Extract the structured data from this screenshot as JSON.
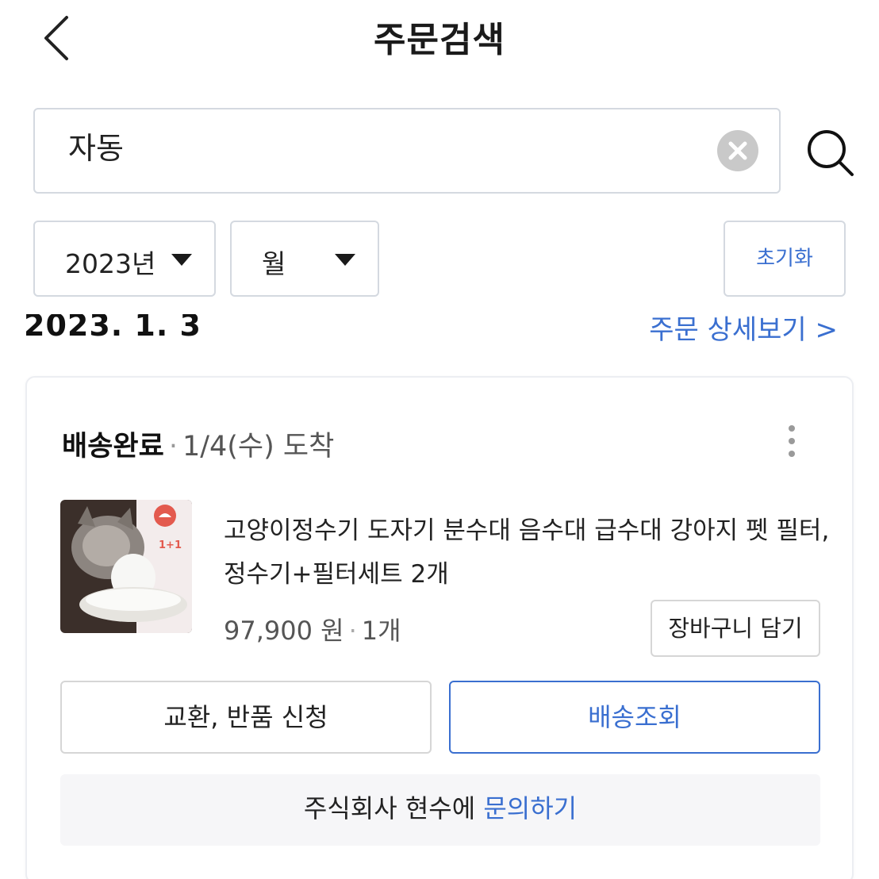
{
  "header": {
    "title": "주문검색"
  },
  "search": {
    "value": "자동"
  },
  "filters": {
    "year_label": "2023년",
    "month_label": "월",
    "reset_label": "초기화"
  },
  "order": {
    "date": "2023. 1. 3",
    "detail_link": "주문 상세보기 >",
    "status": "배송완료",
    "arrival": "1/4(수) 도착",
    "product_name": "고양이정수기 도자기 분수대 음수대 급수대 강아지 펫 필터, 정수기+필터세트 2개",
    "price": "97,900 원",
    "quantity": "1개",
    "cart_button": "장바구니 담기",
    "exchange_button": "교환, 반품 신청",
    "tracking_button": "배송조회",
    "inquiry_prefix": "주식회사 현수에",
    "inquiry_link": "문의하기",
    "thumbnail_badge": "1+1"
  },
  "colors": {
    "accent": "#3a6fd0",
    "border": "#d4d9e0",
    "muted_bg": "#f6f6f8"
  }
}
